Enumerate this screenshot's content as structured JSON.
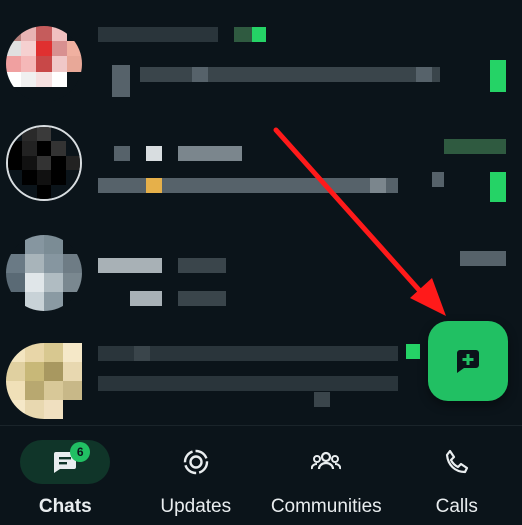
{
  "nav": {
    "items": [
      {
        "label": "Chats",
        "icon": "chats-icon",
        "badge": "6",
        "active": true
      },
      {
        "label": "Updates",
        "icon": "updates-icon",
        "active": false
      },
      {
        "label": "Communities",
        "icon": "communities-icon",
        "active": false
      },
      {
        "label": "Calls",
        "icon": "calls-icon",
        "active": false
      }
    ]
  },
  "fab": {
    "icon": "new-chat-icon"
  },
  "colors": {
    "background": "#0b141a",
    "accent": "#21c063",
    "active_pill": "#103529",
    "annotation_arrow": "#ff1a1a"
  }
}
